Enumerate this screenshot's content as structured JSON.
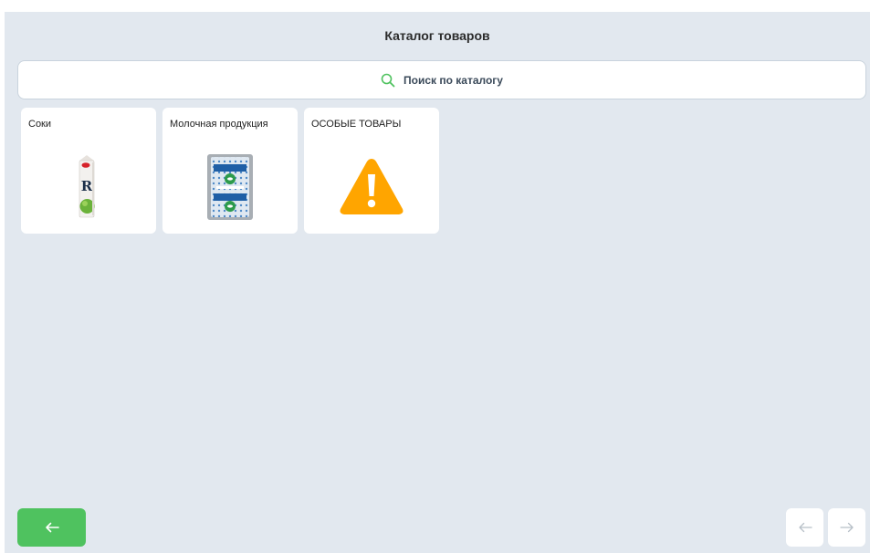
{
  "header": {
    "title": "Каталог товаров"
  },
  "search": {
    "placeholder": "Поиск по каталогу",
    "icon": "search-icon"
  },
  "categories": [
    {
      "label": "Соки",
      "icon": "juice-carton-image"
    },
    {
      "label": "Молочная продукция",
      "icon": "dairy-pack-image"
    },
    {
      "label": "ОСОБЫЕ ТОВАРЫ",
      "icon": "warning-triangle-icon"
    }
  ],
  "footer": {
    "back_icon": "arrow-left-icon",
    "prev_icon": "arrow-left-icon",
    "next_icon": "arrow-right-icon"
  },
  "colors": {
    "background": "#e2e8ef",
    "accent_green": "#4fc25f",
    "warning_orange": "#ffa500"
  }
}
